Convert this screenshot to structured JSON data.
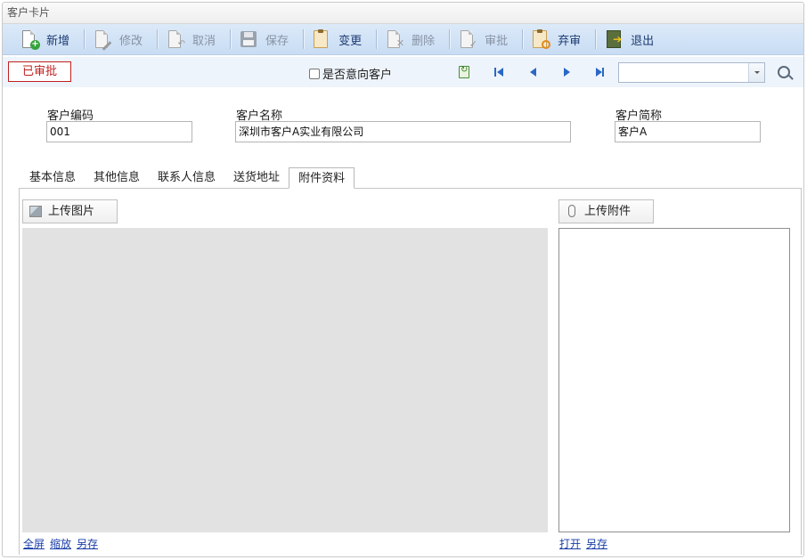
{
  "window": {
    "title": "客户卡片"
  },
  "toolbar": {
    "buttons": [
      {
        "id": "new",
        "label": "新增",
        "icon": "new-document-icon",
        "enabled": true
      },
      {
        "id": "edit",
        "label": "修改",
        "icon": "edit-document-icon",
        "enabled": false
      },
      {
        "id": "cancel",
        "label": "取消",
        "icon": "cancel-document-icon",
        "enabled": false
      },
      {
        "id": "save",
        "label": "保存",
        "icon": "floppy-disk-icon",
        "enabled": false
      },
      {
        "id": "change",
        "label": "变更",
        "icon": "clipboard-icon",
        "enabled": true
      },
      {
        "id": "delete",
        "label": "删除",
        "icon": "delete-document-icon",
        "enabled": false
      },
      {
        "id": "approve",
        "label": "审批",
        "icon": "approve-clipboard-icon",
        "enabled": false
      },
      {
        "id": "abandon",
        "label": "弃审",
        "icon": "abandon-approval-icon",
        "enabled": true
      },
      {
        "id": "exit",
        "label": "退出",
        "icon": "exit-door-icon",
        "enabled": true
      }
    ]
  },
  "status": {
    "badge": "已审批",
    "intent_label": "是否意向客户",
    "intent_checked": false,
    "record_select_value": ""
  },
  "form": {
    "code_label": "客户编码",
    "code_value": "001",
    "name_label": "客户名称",
    "name_value": "深圳市客户A实业有限公司",
    "short_label": "客户简称",
    "short_value": "客户A"
  },
  "tabs": [
    {
      "label": "基本信息",
      "active": false
    },
    {
      "label": "其他信息",
      "active": false
    },
    {
      "label": "联系人信息",
      "active": false
    },
    {
      "label": "送货地址",
      "active": false
    },
    {
      "label": "附件资料",
      "active": true
    }
  ],
  "attachments": {
    "upload_image_label": "上传图片",
    "upload_file_label": "上传附件",
    "image_links": [
      "全屏",
      "缩放",
      "另存"
    ],
    "file_links": [
      "打开",
      "另存"
    ]
  },
  "colors": {
    "toolbar_bg": "#c8dcf3",
    "approved_red": "#c02020",
    "link_blue": "#1a3ea8",
    "image_area_bg": "#e2e2e2"
  }
}
